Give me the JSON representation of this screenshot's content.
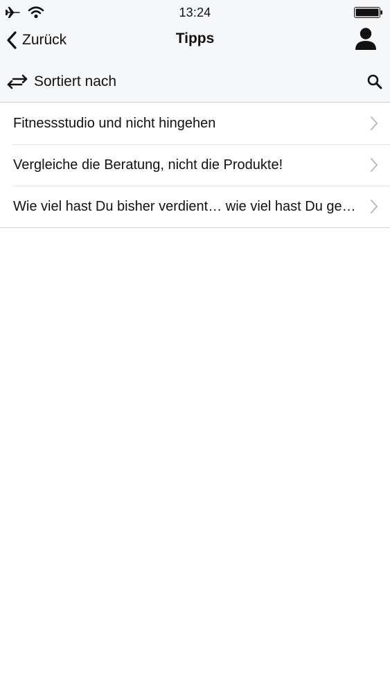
{
  "status_bar": {
    "time": "13:24",
    "icons": [
      "airplane-icon",
      "wifi-icon",
      "battery-icon"
    ]
  },
  "nav": {
    "back_label": "Zurück",
    "title": "Tipps",
    "right_icon": "profile-icon"
  },
  "toolbar": {
    "sort_label": "Sortiert nach",
    "sort_icon": "swap-arrows-icon",
    "search_icon": "search-icon"
  },
  "list": {
    "items": [
      {
        "label": "Fitnessstudio und nicht hingehen"
      },
      {
        "label": "Vergleiche die Beratung, nicht die Produkte!"
      },
      {
        "label": "Wie viel hast Du bisher verdient… wie viel hast Du gespart?"
      }
    ]
  },
  "colors": {
    "header_background": "#f6f7f9",
    "separator": "#cfd3d8",
    "chevron": "#b9bcc1",
    "text": "#111111"
  }
}
